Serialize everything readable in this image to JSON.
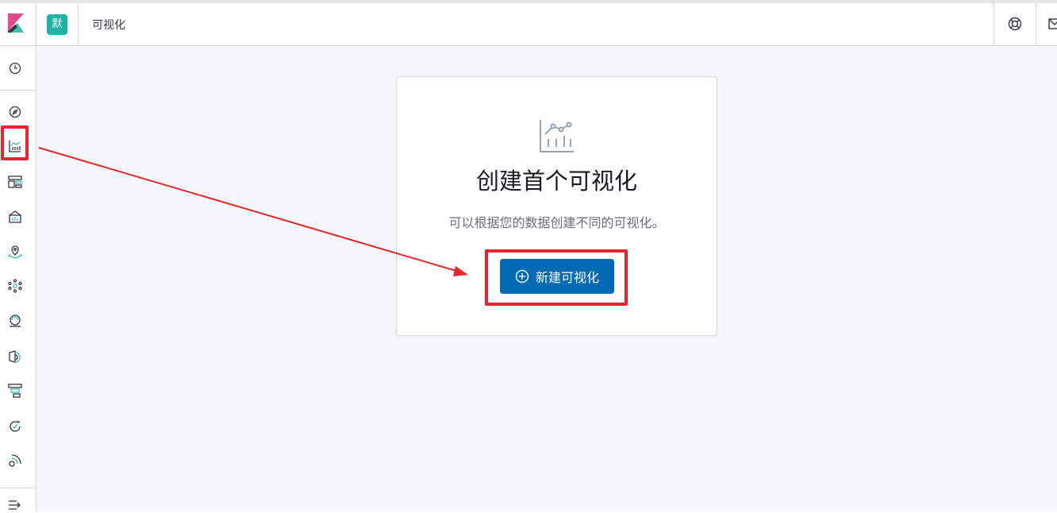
{
  "header": {
    "space_initial": "默",
    "breadcrumb": "可视化",
    "help_icon": "lifebuoy-icon",
    "mail_icon": "mail-icon"
  },
  "sidebar": {
    "items": [
      {
        "name": "recently-viewed",
        "icon": "clock-icon"
      },
      {
        "name": "discover",
        "icon": "compass-icon"
      },
      {
        "name": "visualize",
        "icon": "visualize-icon",
        "highlighted": true
      },
      {
        "name": "dashboard",
        "icon": "dashboard-icon"
      },
      {
        "name": "canvas",
        "icon": "canvas-icon"
      },
      {
        "name": "maps",
        "icon": "maps-icon"
      },
      {
        "name": "machine-learning",
        "icon": "ml-icon"
      },
      {
        "name": "infrastructure",
        "icon": "infrastructure-icon"
      },
      {
        "name": "logs",
        "icon": "logs-icon"
      },
      {
        "name": "apm",
        "icon": "apm-icon"
      },
      {
        "name": "uptime",
        "icon": "uptime-icon"
      },
      {
        "name": "siem",
        "icon": "siem-icon"
      }
    ],
    "collapse_icon": "collapse-menu-icon"
  },
  "empty_state": {
    "icon": "visualize-app-icon",
    "title": "创建首个可视化",
    "description": "可以根据您的数据创建不同的可视化。",
    "button_label": "新建可视化",
    "button_icon": "plus-circle-icon"
  },
  "annotation": {
    "color": "#e5262e"
  },
  "colors": {
    "primary": "#006bb4",
    "space_badge": "#20b4a7",
    "logo_pink": "#e8478b",
    "logo_teal": "#3ebeb0"
  }
}
